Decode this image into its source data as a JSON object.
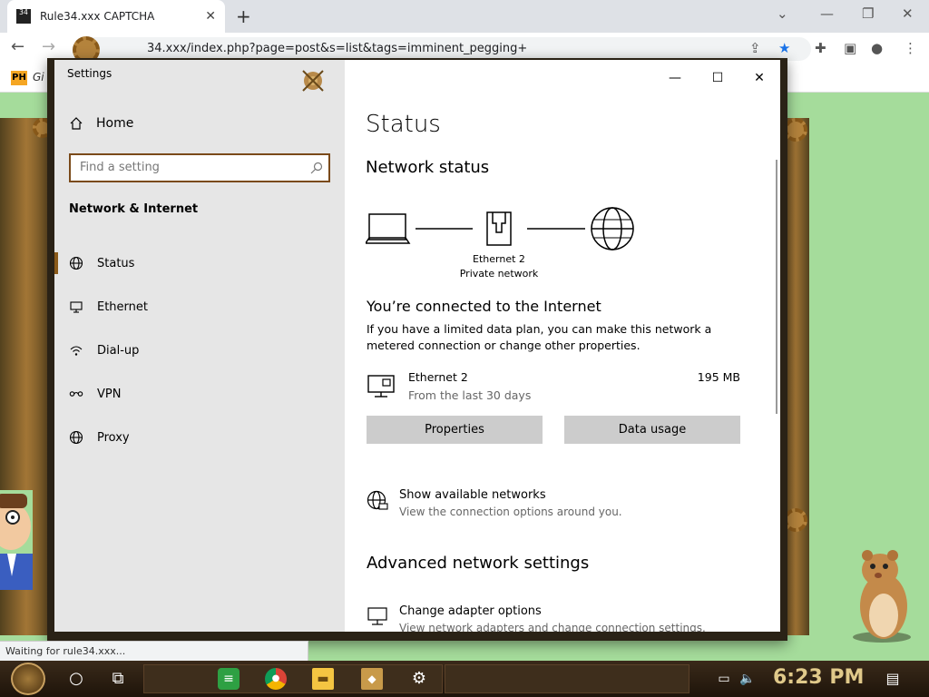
{
  "browser": {
    "tab_favicon": "34",
    "tab_title": "Rule34.xxx CAPTCHA",
    "tab_close": "✕",
    "new_tab": "+",
    "url": "34.xxx/index.php?page=post&s=list&tags=imminent_pegging+",
    "bookmark_icon": "PH",
    "bookmark_label": "Gi",
    "status_text": "Waiting for rule34.xxx..."
  },
  "settings": {
    "app_title": "Settings",
    "sidebar": {
      "home": "Home",
      "search_placeholder": "Find a setting",
      "section": "Network & Internet",
      "items": [
        {
          "label": "Status",
          "icon": "globe-icon"
        },
        {
          "label": "Ethernet",
          "icon": "ethernet-icon"
        },
        {
          "label": "Dial-up",
          "icon": "dialup-icon"
        },
        {
          "label": "VPN",
          "icon": "vpn-icon"
        },
        {
          "label": "Proxy",
          "icon": "globe-icon"
        }
      ]
    },
    "window_controls": {
      "minimize": "—",
      "maximize": "☐",
      "close": "✕"
    },
    "main": {
      "title": "Status",
      "network_status": "Network status",
      "diagram_line1": "Ethernet 2",
      "diagram_line2": "Private network",
      "connected": "You’re connected to the Internet",
      "connected_desc": "If you have a limited data plan, you can make this network a metered connection or change other properties.",
      "ethernet_name": "Ethernet 2",
      "ethernet_sub": "From the last 30 days",
      "ethernet_size": "195 MB",
      "properties_button": "Properties",
      "data_usage_button": "Data usage",
      "show_networks_title": "Show available networks",
      "show_networks_sub": "View the connection options around you.",
      "advanced_title": "Advanced network settings",
      "adapter_title": "Change adapter options",
      "adapter_sub": "View network adapters and change connection settings."
    }
  },
  "taskbar": {
    "clock": "6:23 PM"
  }
}
